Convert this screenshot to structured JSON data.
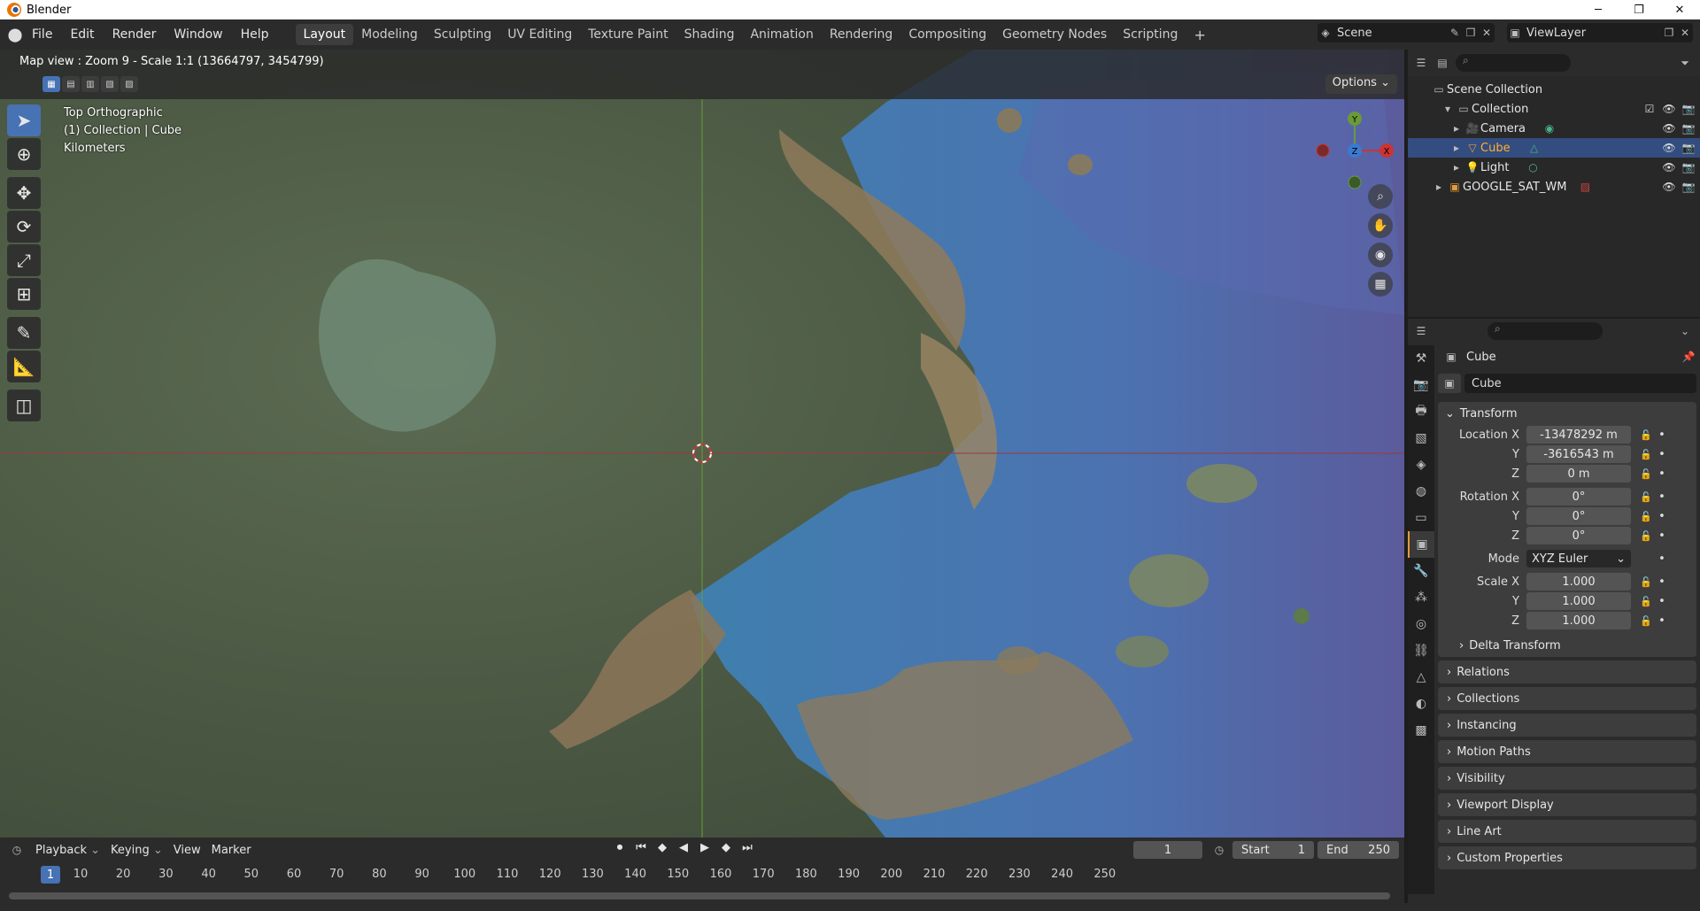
{
  "window": {
    "title": "Blender",
    "min": "─",
    "max": "❐",
    "close": "✕"
  },
  "menu": [
    "File",
    "Edit",
    "Render",
    "Window",
    "Help"
  ],
  "workspaces": [
    {
      "label": "Layout",
      "active": true
    },
    {
      "label": "Modeling"
    },
    {
      "label": "Sculpting"
    },
    {
      "label": "UV Editing"
    },
    {
      "label": "Texture Paint"
    },
    {
      "label": "Shading"
    },
    {
      "label": "Animation"
    },
    {
      "label": "Rendering"
    },
    {
      "label": "Compositing"
    },
    {
      "label": "Geometry Nodes"
    },
    {
      "label": "Scripting"
    }
  ],
  "workspace_add": "+",
  "scene": {
    "label": "Scene"
  },
  "viewlayer": {
    "label": "ViewLayer"
  },
  "viewport": {
    "map_info": "Map view : Zoom 9 - Scale 1:1 (13664797, 3454799)",
    "options": "Options",
    "overlay": [
      "Top Orthographic",
      "(1) Collection | Cube",
      "Kilometers"
    ],
    "gizmo": {
      "y": "Y",
      "x": "X",
      "z": "Z"
    }
  },
  "outliner": {
    "root": "Scene Collection",
    "collection": "Collection",
    "items": [
      {
        "name": "Camera",
        "selected": false
      },
      {
        "name": "Cube",
        "selected": true
      },
      {
        "name": "Light",
        "selected": false
      }
    ],
    "extra": "GOOGLE_SAT_WM"
  },
  "properties": {
    "object_name": "Cube",
    "data_name": "Cube",
    "transform": {
      "title": "Transform",
      "location": {
        "label": "Location X",
        "x": "-13478292 m",
        "y": "-3616543 m",
        "z": "0 m"
      },
      "rotation": {
        "label": "Rotation X",
        "x": "0°",
        "y": "0°",
        "z": "0°"
      },
      "mode": {
        "label": "Mode",
        "value": "XYZ Euler"
      },
      "scale": {
        "label": "Scale X",
        "x": "1.000",
        "y": "1.000",
        "z": "1.000"
      },
      "y_label": "Y",
      "z_label": "Z"
    },
    "delta": "Delta Transform",
    "panels": [
      "Relations",
      "Collections",
      "Instancing",
      "Motion Paths",
      "Visibility",
      "Viewport Display",
      "Line Art",
      "Custom Properties"
    ]
  },
  "timeline": {
    "menus": [
      "Playback",
      "Keying",
      "View",
      "Marker"
    ],
    "current": "1",
    "start_label": "Start",
    "start": "1",
    "end_label": "End",
    "end": "250",
    "playhead": "1",
    "ticks": [
      "10",
      "20",
      "30",
      "40",
      "50",
      "60",
      "70",
      "80",
      "90",
      "100",
      "110",
      "120",
      "130",
      "140",
      "150",
      "160",
      "170",
      "180",
      "190",
      "200",
      "210",
      "220",
      "230",
      "240",
      "250"
    ]
  },
  "colors": {
    "accent": "#4772b3",
    "selected_row": "#334d80",
    "object_orange": "#e69a3b"
  }
}
